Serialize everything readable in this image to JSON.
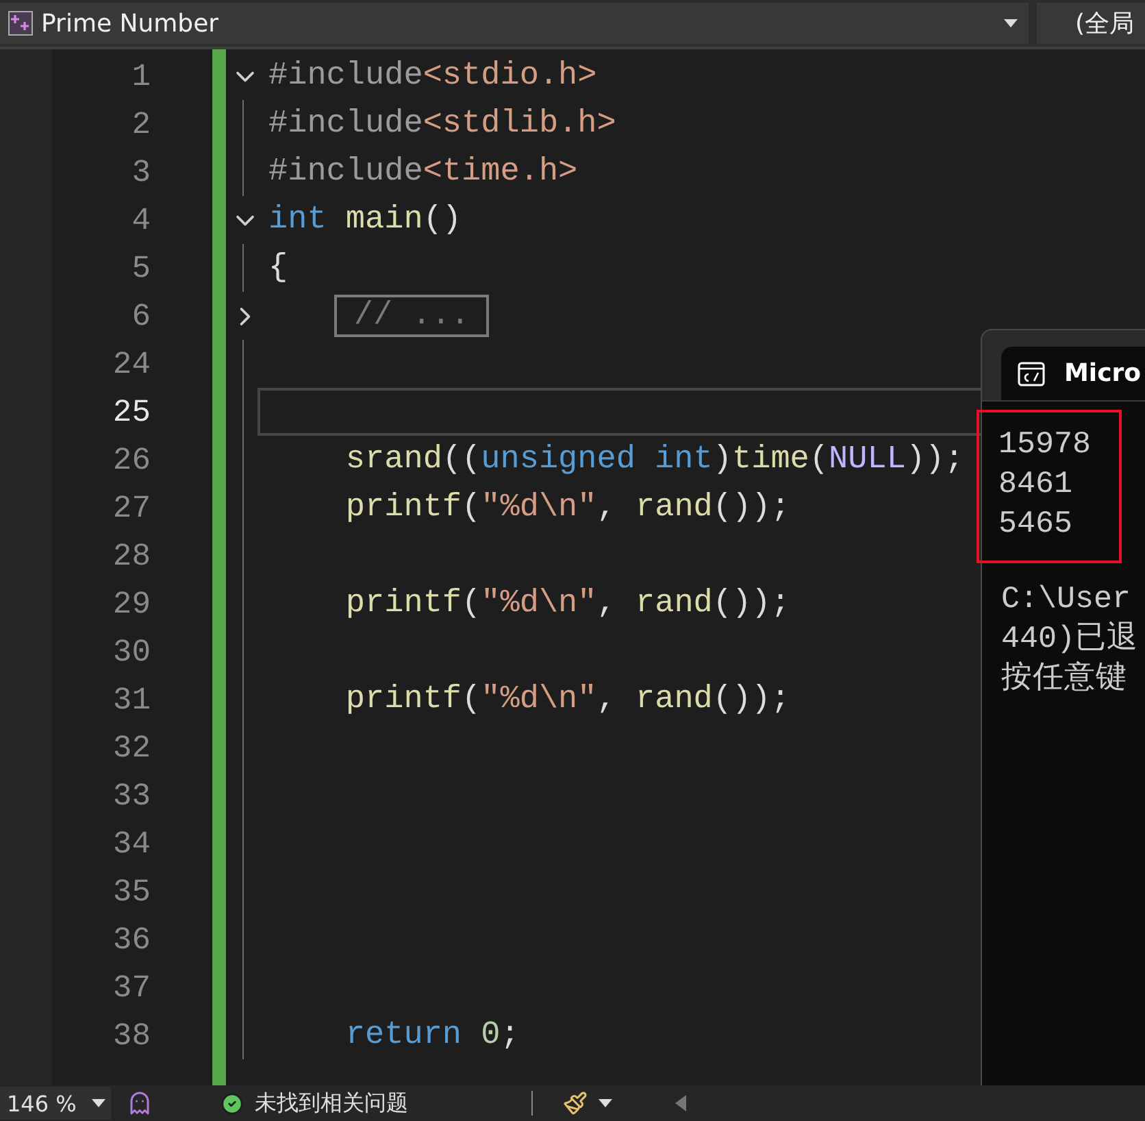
{
  "editor_header": {
    "file": "Prime Number",
    "scope": "(全局"
  },
  "code_lines": [
    {
      "number": "1",
      "expanded": true,
      "in_block": false,
      "current": false,
      "tokens": [
        {
          "kind": "directive",
          "text": "#include"
        },
        {
          "kind": "header",
          "text": "<stdio.h>"
        }
      ]
    },
    {
      "number": "2",
      "in_block": true,
      "current": false,
      "tokens": [
        {
          "kind": "directive",
          "text": "#include"
        },
        {
          "kind": "header",
          "text": "<stdlib.h>"
        }
      ]
    },
    {
      "number": "3",
      "in_block": true,
      "current": false,
      "tokens": [
        {
          "kind": "directive",
          "text": "#include"
        },
        {
          "kind": "header",
          "text": "<time.h>"
        }
      ]
    },
    {
      "number": "4",
      "expanded": true,
      "in_block": false,
      "current": false,
      "tokens": [
        {
          "kind": "keyword",
          "text": "int"
        },
        {
          "kind": "function",
          "text": "main",
          "space_before": true
        },
        {
          "kind": "plain",
          "text": "()"
        }
      ]
    },
    {
      "number": "5",
      "in_block": true,
      "current": false,
      "tokens": [
        {
          "kind": "plain",
          "text": "{"
        }
      ]
    },
    {
      "number": "6",
      "expanded": false,
      "in_block": false,
      "current": false,
      "indent": true,
      "tokens": [
        {
          "kind": "collapsed",
          "text": "// ..."
        }
      ]
    },
    {
      "number": "24",
      "in_block": true,
      "current": false
    },
    {
      "number": "25",
      "in_block": true,
      "current": true
    },
    {
      "number": "26",
      "in_block": true,
      "current": false,
      "indent": true,
      "tokens": [
        {
          "kind": "function",
          "text": "srand"
        },
        {
          "kind": "plain",
          "text": "(("
        },
        {
          "kind": "keyword",
          "text": "unsigned int"
        },
        {
          "kind": "plain",
          "text": ")"
        },
        {
          "kind": "function",
          "text": "time"
        },
        {
          "kind": "plain",
          "text": "("
        },
        {
          "kind": "macro",
          "text": "NULL"
        },
        {
          "kind": "plain",
          "text": "));"
        }
      ]
    },
    {
      "number": "27",
      "in_block": true,
      "current": false,
      "indent": true,
      "tokens": [
        {
          "kind": "function",
          "text": "printf"
        },
        {
          "kind": "plain",
          "text": "("
        },
        {
          "kind": "string",
          "text": "\"%d\\n\""
        },
        {
          "kind": "plain",
          "text": ", "
        },
        {
          "kind": "function",
          "text": "rand"
        },
        {
          "kind": "plain",
          "text": "());"
        }
      ]
    },
    {
      "number": "28",
      "in_block": true,
      "current": false
    },
    {
      "number": "29",
      "in_block": true,
      "current": false,
      "indent": true,
      "tokens": [
        {
          "kind": "function",
          "text": "printf"
        },
        {
          "kind": "plain",
          "text": "("
        },
        {
          "kind": "string",
          "text": "\"%d\\n\""
        },
        {
          "kind": "plain",
          "text": ", "
        },
        {
          "kind": "function",
          "text": "rand"
        },
        {
          "kind": "plain",
          "text": "());"
        }
      ]
    },
    {
      "number": "30",
      "in_block": true,
      "current": false
    },
    {
      "number": "31",
      "in_block": true,
      "current": false,
      "indent": true,
      "tokens": [
        {
          "kind": "function",
          "text": "printf"
        },
        {
          "kind": "plain",
          "text": "("
        },
        {
          "kind": "string",
          "text": "\"%d\\n\""
        },
        {
          "kind": "plain",
          "text": ", "
        },
        {
          "kind": "function",
          "text": "rand"
        },
        {
          "kind": "plain",
          "text": "());"
        }
      ]
    },
    {
      "number": "32",
      "in_block": true,
      "current": false
    },
    {
      "number": "33",
      "in_block": true,
      "current": false
    },
    {
      "number": "34",
      "in_block": true,
      "current": false
    },
    {
      "number": "35",
      "in_block": true,
      "current": false
    },
    {
      "number": "36",
      "in_block": true,
      "current": false
    },
    {
      "number": "37",
      "in_block": true,
      "current": false
    },
    {
      "number": "38",
      "in_block": true,
      "current": false,
      "indent": true,
      "tokens": [
        {
          "kind": "keyword",
          "text": "return"
        },
        {
          "kind": "number",
          "text": "0",
          "space_before": true
        },
        {
          "kind": "plain",
          "text": ";"
        }
      ]
    }
  ],
  "console": {
    "tab_title": "Micro",
    "output_highlighted": true,
    "output": [
      "15978",
      "8461",
      "5465"
    ],
    "message": [
      "C:\\User",
      "440)已退",
      "按任意键"
    ]
  },
  "status_bar": {
    "zoom": "146 %",
    "issues": "未找到相关问题"
  }
}
